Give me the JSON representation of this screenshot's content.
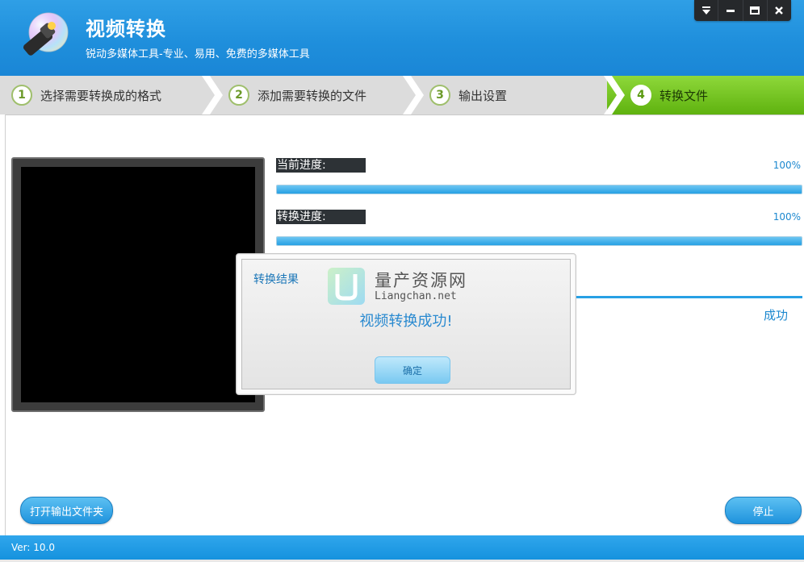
{
  "header": {
    "title": "视频转换",
    "subtitle": "锐动多媒体工具-专业、易用、免费的多媒体工具",
    "controls": [
      {
        "name": "menu-dropdown-icon"
      },
      {
        "name": "minimize-icon"
      },
      {
        "name": "maximize-icon"
      },
      {
        "name": "close-icon"
      }
    ]
  },
  "steps": [
    {
      "num": "1",
      "label": "选择需要转换成的格式"
    },
    {
      "num": "2",
      "label": "添加需要转换的文件"
    },
    {
      "num": "3",
      "label": "输出设置"
    },
    {
      "num": "4",
      "label": "转换文件",
      "active": true
    }
  ],
  "progress": {
    "current": {
      "label": "当前进度:",
      "percent_text": "100%",
      "value": 1.0
    },
    "overall": {
      "label": "转换进度:",
      "percent_text": "100%",
      "value": 1.0
    },
    "status": "成功"
  },
  "dialog": {
    "title": "转换结果",
    "message": "视频转换成功!",
    "ok_label": "确定",
    "watermark_cn": "量产资源网",
    "watermark_en": "Liangchan.net"
  },
  "buttons": {
    "open_folder": "打开输出文件夹",
    "stop": "停止"
  },
  "footer": {
    "version": "Ver: 10.0"
  },
  "colors": {
    "primary_blue": "#1f8fdc",
    "active_step_green": "#6cc01c",
    "accent_text": "#1c88cf"
  }
}
